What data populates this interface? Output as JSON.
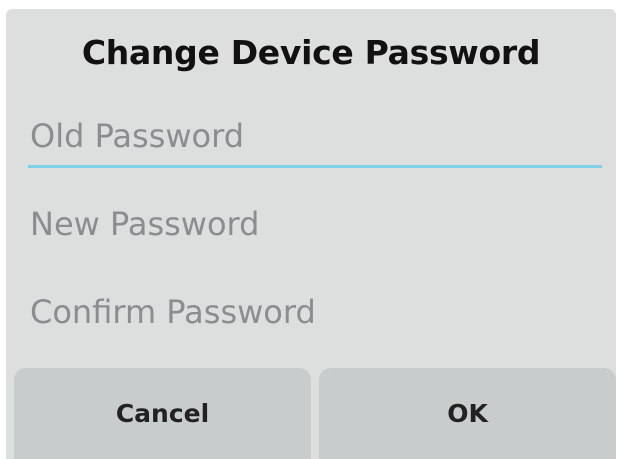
{
  "dialog": {
    "title": "Change Device Password",
    "fields": {
      "old_password": {
        "placeholder": "Old Password",
        "value": ""
      },
      "new_password": {
        "placeholder": "New Password",
        "value": ""
      },
      "confirm_password": {
        "placeholder": "Confirm Password",
        "value": ""
      }
    },
    "buttons": {
      "cancel_label": "Cancel",
      "ok_label": "OK"
    },
    "colors": {
      "focus_underline": "#7fd0e6",
      "dialog_bg": "#dcdfde",
      "button_bg": "#c9cccd"
    }
  }
}
